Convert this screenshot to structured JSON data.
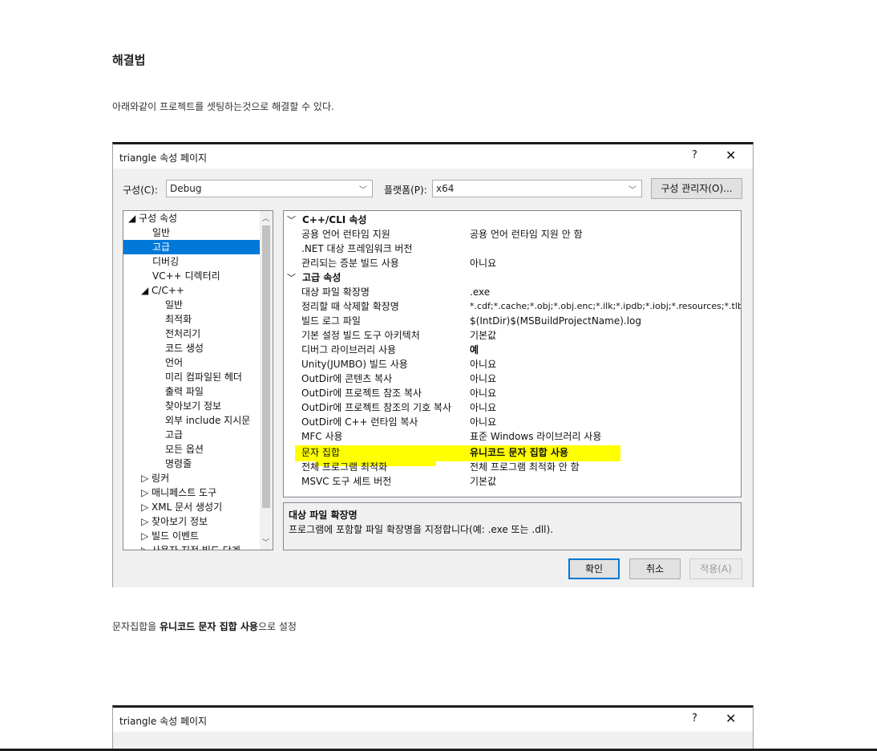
{
  "article": {
    "heading": "해결법",
    "intro": "아래와같이 프로젝트를 셋팅하는것으로 해결할 수 있다.",
    "summary_pre": "문자집합을 ",
    "summary_bold": "유니코드 문자 집합 사용",
    "summary_post": "으로 설정"
  },
  "dialog": {
    "title": "triangle 속성 페이지",
    "help": "?",
    "close": "✕",
    "config_label": "구성(C):",
    "config_value": "Debug",
    "platform_label": "플랫폼(P):",
    "platform_value": "x64",
    "config_manager": "구성 관리자(O)...",
    "ok": "확인",
    "cancel": "취소",
    "apply": "적용(A)",
    "tree": [
      {
        "text": "◢ 구성 속성"
      },
      {
        "text": "일반"
      },
      {
        "text": "고급"
      },
      {
        "text": "디버깅"
      },
      {
        "text": "VC++ 디렉터리"
      },
      {
        "text": "◢ C/C++"
      },
      {
        "text": "일반"
      },
      {
        "text": "최적화"
      },
      {
        "text": "전처리기"
      },
      {
        "text": "코드 생성"
      },
      {
        "text": "언어"
      },
      {
        "text": "미리 컴파일된 헤더"
      },
      {
        "text": "출력 파일"
      },
      {
        "text": "찾아보기 정보"
      },
      {
        "text": "외부 include 지시문"
      },
      {
        "text": "고급"
      },
      {
        "text": "모든 옵션"
      },
      {
        "text": "명령줄"
      },
      {
        "text": "▷ 링커"
      },
      {
        "text": "▷ 매니페스트 도구"
      },
      {
        "text": "▷ XML 문서 생성기"
      },
      {
        "text": "▷ 찾아보기 정보"
      },
      {
        "text": "▷ 빌드 이벤트"
      },
      {
        "text": "▷ 사용자 지정 빌드 단계"
      }
    ],
    "grid": {
      "section1": "C++/CLI 속성",
      "rows1": [
        {
          "name": "공용 언어 런타임 지원",
          "value": "공용 언어 런타임 지원 안 함"
        },
        {
          "name": ".NET 대상 프레임워크 버전",
          "value": ""
        },
        {
          "name": "관리되는 증분 빌드 사용",
          "value": "아니요"
        }
      ],
      "section2": "고급 속성",
      "rows2": [
        {
          "name": "대상 파일 확장명",
          "value": ".exe"
        },
        {
          "name": "정리할 때 삭제할 확장명",
          "value": "*.cdf;*.cache;*.obj;*.obj.enc;*.ilk;*.ipdb;*.iobj;*.resources;*.tlb;*.tli;"
        },
        {
          "name": "빌드 로그 파일",
          "value": "$(IntDir)$(MSBuildProjectName).log"
        },
        {
          "name": "기본 설정 빌드 도구 아키텍처",
          "value": "기본값"
        },
        {
          "name": "디버그 라이브러리 사용",
          "value": "예"
        },
        {
          "name": "Unity(JUMBO) 빌드 사용",
          "value": "아니요"
        },
        {
          "name": "OutDir에 콘텐츠 복사",
          "value": "아니요"
        },
        {
          "name": "OutDir에 프로젝트 참조 복사",
          "value": "아니요"
        },
        {
          "name": "OutDir에 프로젝트 참조의 기호 복사",
          "value": "아니요"
        },
        {
          "name": "OutDir에 C++ 런타임 복사",
          "value": "아니요"
        },
        {
          "name": "MFC 사용",
          "value": "표준 Windows 라이브러리 사용"
        },
        {
          "name": "문자 집합",
          "value": "유니코드 문자 집합 사용"
        },
        {
          "name": "전체 프로그램 최적화",
          "value": "전체 프로그램 최적화 안 함"
        },
        {
          "name": "MSVC 도구 세트 버전",
          "value": "기본값"
        }
      ]
    },
    "desc_title": "대상 파일 확장명",
    "desc_body": "프로그램에 포함할 파일 확장명을 지정합니다(예: .exe 또는 .dll)."
  },
  "dialog2": {
    "title": "triangle 속성 페이지",
    "help": "?",
    "close": "✕"
  },
  "colors": {
    "highlight": "#ffff00",
    "selection": "#0078d7"
  }
}
